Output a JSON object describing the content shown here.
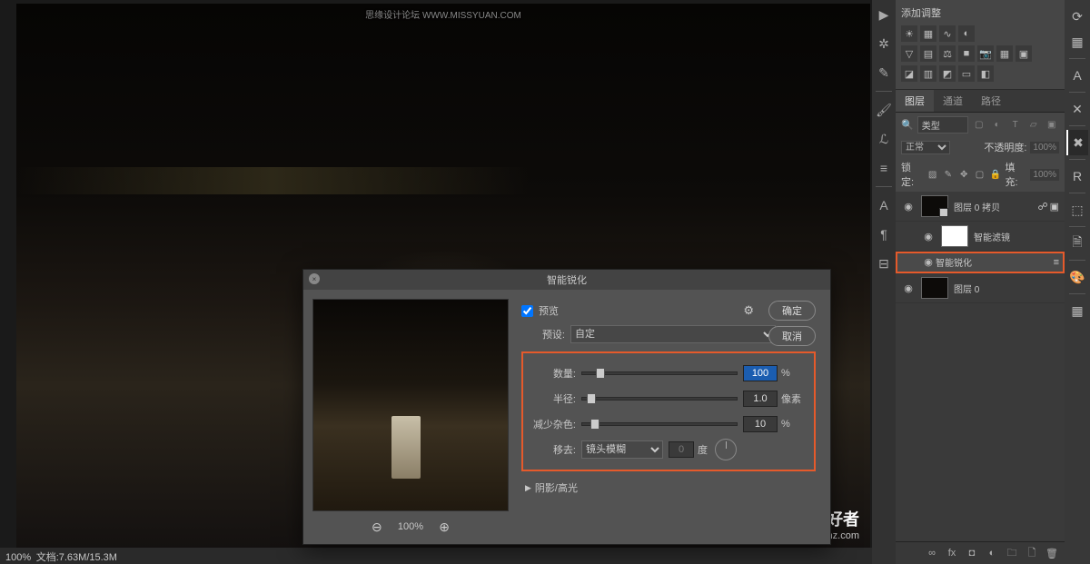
{
  "watermarks": {
    "top": "思缘设计论坛  WWW.MISSYUAN.COM",
    "brand_big": "PS 爱好者",
    "brand_url": "www.psahz.com"
  },
  "status": {
    "zoom": "100%",
    "doc": "文档:7.63M/15.3M"
  },
  "adj_panel": {
    "title": "添加调整"
  },
  "layers_panel": {
    "tabs": {
      "layers": "图层",
      "channels": "通道",
      "paths": "路径"
    },
    "type_search": "类型",
    "blend_mode": "正常",
    "opacity_label": "不透明度:",
    "opacity_value": "100%",
    "lock_label": "锁定:",
    "fill_label": "填充:",
    "fill_value": "100%",
    "items": [
      {
        "name": "图层 0 拷贝"
      },
      {
        "name": "智能滤镜"
      },
      {
        "name": "智能锐化"
      },
      {
        "name": "图层 0"
      }
    ]
  },
  "dialog": {
    "title": "智能锐化",
    "preview_label": "预览",
    "ok": "确定",
    "cancel": "取消",
    "preset_label": "预设:",
    "preset_value": "自定",
    "sliders": {
      "amount": {
        "label": "数量:",
        "value": "100",
        "unit": "%",
        "pos": 12
      },
      "radius": {
        "label": "半径:",
        "value": "1.0",
        "unit": "像素",
        "pos": 6
      },
      "noise": {
        "label": "减少杂色:",
        "value": "10",
        "unit": "%",
        "pos": 8
      }
    },
    "remove": {
      "label": "移去:",
      "value": "镜头模糊",
      "angle": "0",
      "angle_unit": "度"
    },
    "accordion": "阴影/高光",
    "zoom": "100%"
  }
}
